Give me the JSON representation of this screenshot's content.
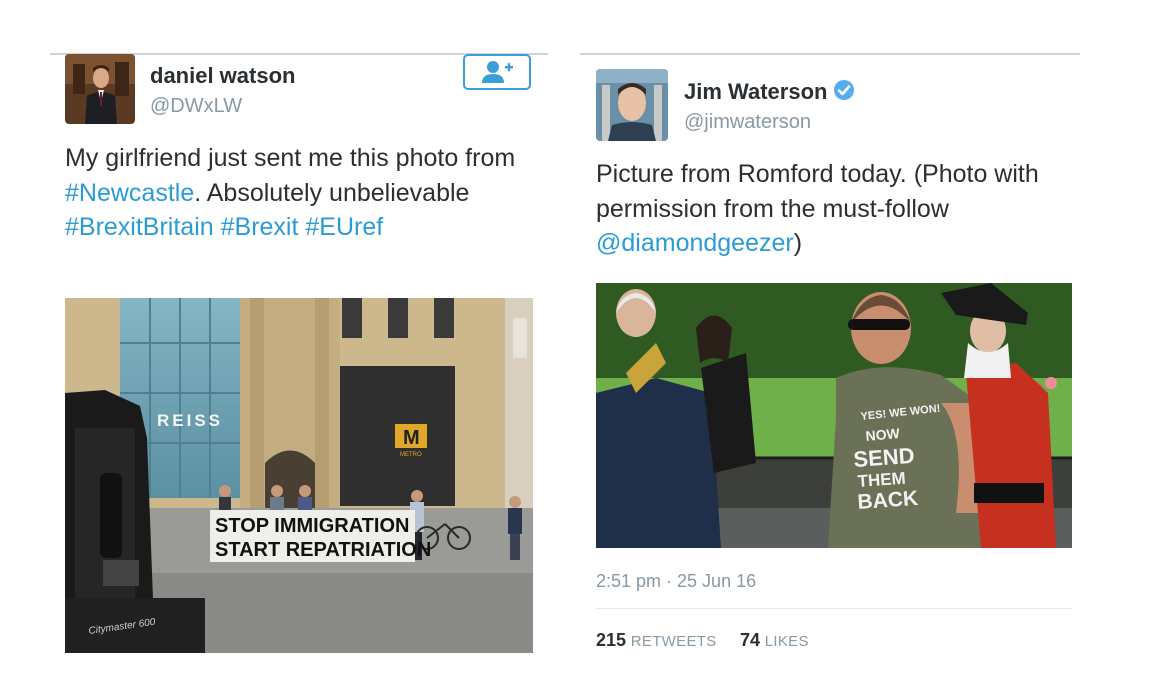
{
  "tweet_left": {
    "name": "daniel watson",
    "handle": "@DWxLW",
    "text_parts": {
      "p1": "My girlfriend just sent me this photo from ",
      "tag1": "#Newcastle",
      "p2": ". Absolutely unbelievable ",
      "tag2": "#BrexitBritain",
      "p3": " ",
      "tag3": "#Brexit",
      "p4": " ",
      "tag4": "#EUref"
    },
    "photo": {
      "store_sign": "REISS",
      "metro_sign": "M",
      "metro_sub": "METRO",
      "banner_line1": "STOP IMMIGRATION",
      "banner_line2": "START REPATRIATION",
      "vehicle_text": "Citymaster 600"
    }
  },
  "tweet_right": {
    "name": "Jim Waterson",
    "handle": "@jimwaterson",
    "text_parts": {
      "p1": "Picture from Romford today. (Photo with permission from the must-follow ",
      "mention": "@diamondgeezer",
      "p2": ")"
    },
    "photo": {
      "shirt_line1": "YES! WE WON!",
      "shirt_line2": "NOW",
      "shirt_line3": "SEND",
      "shirt_line4": "THEM",
      "shirt_line5": "BACK"
    },
    "timestamp": "2:51 pm · 25 Jun 16",
    "retweets_count": "215",
    "retweets_label": "RETWEETS",
    "likes_count": "74",
    "likes_label": "LIKES"
  },
  "colors": {
    "link": "#2b9bd6",
    "muted": "#8899a6",
    "text": "#292f33",
    "verified": "#55acee"
  }
}
